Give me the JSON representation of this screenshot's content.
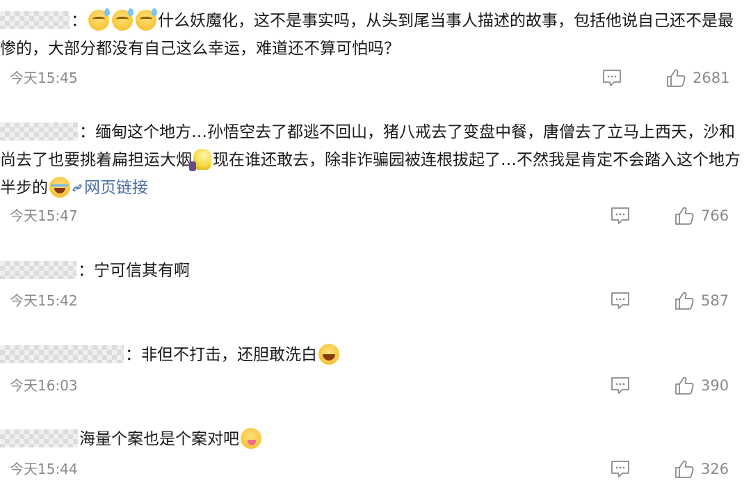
{
  "comments": [
    {
      "parts": [
        {
          "kind": "mosaic",
          "w": 100
        },
        {
          "kind": "text",
          "value": "："
        },
        {
          "kind": "emoji",
          "name": "sweat-smile-emoji",
          "style": "sweat"
        },
        {
          "kind": "emoji",
          "name": "sweat-smile-emoji",
          "style": "sweat"
        },
        {
          "kind": "emoji",
          "name": "sweat-smile-emoji",
          "style": "sweat"
        },
        {
          "kind": "text",
          "value": "什么妖魔化，这不是事实吗，从头到尾当事人描述的故事，包括他说自己还不是最惨的，大部分都没有自己这么幸运，难道还不算可怕吗？"
        }
      ],
      "time": "今天15:45",
      "likes": "2681"
    },
    {
      "parts": [
        {
          "kind": "mosaic",
          "w": 112
        },
        {
          "kind": "text",
          "value": "：缅甸这个地方…孙悟空去了都逃不回山，猪八戒去了变盘中餐，唐僧去了立马上西天，沙和尚去了也要挑着扁担运大烟"
        },
        {
          "kind": "emoji",
          "name": "lightbulb-emoji",
          "style": "bulb"
        },
        {
          "kind": "text",
          "value": "现在谁还敢去，除非诈骗园被连根拔起了…不然我是肯定不会踏入这个地方半步的"
        },
        {
          "kind": "emoji",
          "name": "crying-emoji",
          "style": "cry"
        },
        {
          "kind": "link",
          "value": "网页链接"
        }
      ],
      "time": "今天15:47",
      "likes": "766"
    },
    {
      "parts": [
        {
          "kind": "mosaic",
          "w": 110
        },
        {
          "kind": "text",
          "value": "：宁可信其有啊"
        }
      ],
      "time": "今天15:42",
      "likes": "587"
    },
    {
      "parts": [
        {
          "kind": "mosaic",
          "w": 178
        },
        {
          "kind": "text",
          "value": "：非但不打击，还胆敢洗白"
        },
        {
          "kind": "emoji",
          "name": "laughing-crying-emoji",
          "style": "laugh"
        }
      ],
      "time": "今天16:03",
      "likes": "390"
    },
    {
      "parts": [
        {
          "kind": "mosaic",
          "w": 112
        },
        {
          "kind": "text",
          "value": "海量个案也是个案对吧"
        },
        {
          "kind": "emoji",
          "name": "yum-emoji",
          "style": "yum"
        }
      ],
      "time": "今天15:44",
      "likes": "326"
    }
  ],
  "icons": {
    "reply": "comment-bubble-icon",
    "like": "thumbs-up-icon",
    "link": "link-icon"
  },
  "colors": {
    "meta_gray": "#8a8a8a",
    "link_blue": "#4a6fa5"
  }
}
